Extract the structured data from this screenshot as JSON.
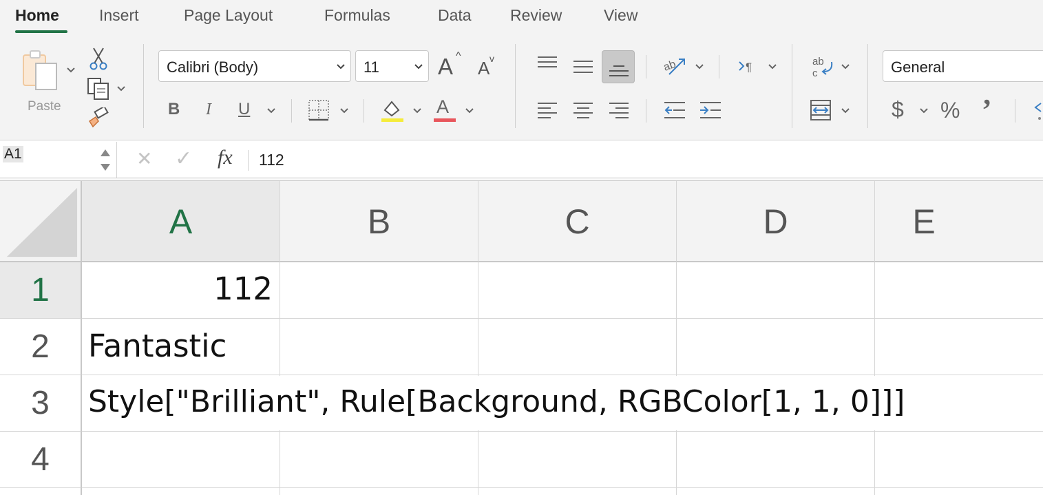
{
  "tabs": [
    {
      "label": "Home",
      "active": true
    },
    {
      "label": "Insert"
    },
    {
      "label": "Page Layout"
    },
    {
      "label": "Formulas"
    },
    {
      "label": "Data"
    },
    {
      "label": "Review"
    },
    {
      "label": "View"
    }
  ],
  "ribbon": {
    "clipboard": {
      "paste_label": "Paste"
    },
    "font": {
      "font_name": "Calibri (Body)",
      "font_size": "11",
      "bold_glyph": "B",
      "italic_glyph": "I",
      "underline_glyph": "U",
      "increase_glyph": "A",
      "decrease_glyph": "A",
      "font_color_glyph": "A",
      "highlight_color": "#f5ec3b",
      "font_color": "#e8565c"
    },
    "number": {
      "format": "General",
      "currency_glyph": "$",
      "percent_glyph": "%",
      "comma_glyph": "’"
    },
    "icons": [
      "paste-icon",
      "cut-icon",
      "copy-icon",
      "format-painter-icon",
      "borders-icon",
      "fill-color-icon",
      "font-color-icon",
      "align-top-icon",
      "align-middle-icon",
      "align-bottom-icon",
      "align-left-icon",
      "align-center-icon",
      "align-right-icon",
      "orientation-icon",
      "text-direction-icon",
      "decrease-indent-icon",
      "increase-indent-icon",
      "wrap-text-icon",
      "merge-icon"
    ]
  },
  "formula_bar": {
    "name_box": "A1",
    "fx_label": "fx",
    "cancel_glyph": "✕",
    "enter_glyph": "✓",
    "content": "112"
  },
  "sheet": {
    "columns": [
      "A",
      "B",
      "C",
      "D",
      "E"
    ],
    "selected_column": "A",
    "rows": [
      "1",
      "2",
      "3",
      "4"
    ],
    "selected_row": "1",
    "cells": {
      "A1": "112",
      "A2": "Fantastic",
      "A3": "Style[\"Brilliant\", Rule[Background, RGBColor[1, 1, 0]]]"
    }
  },
  "colors": {
    "accent": "#217346",
    "ribbon_bg": "#f3f3f3",
    "gridline": "#d6d6d6"
  }
}
